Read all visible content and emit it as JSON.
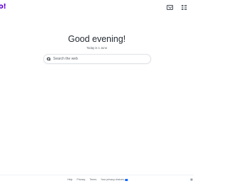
{
  "header": {
    "logo_text": "o!",
    "mail_icon": "mail-icon",
    "apps_icon": "apps-grid-icon"
  },
  "main": {
    "greeting": "Good evening!",
    "date": "Today is 1 June",
    "search": {
      "placeholder": "Search the web",
      "value": "",
      "icon": "search-icon"
    }
  },
  "footer": {
    "links": {
      "help": "Help",
      "privacy": "Privacy",
      "terms": "Terms",
      "privacy_choices": "Your privacy choices"
    },
    "privacy_toggle_icon": "privacy-toggle-icon",
    "settings_icon": "settings-icon"
  },
  "colors": {
    "brand": "#6001d2",
    "text": "#232a31",
    "muted": "#5b636a",
    "toggle": "#0f69ff"
  }
}
